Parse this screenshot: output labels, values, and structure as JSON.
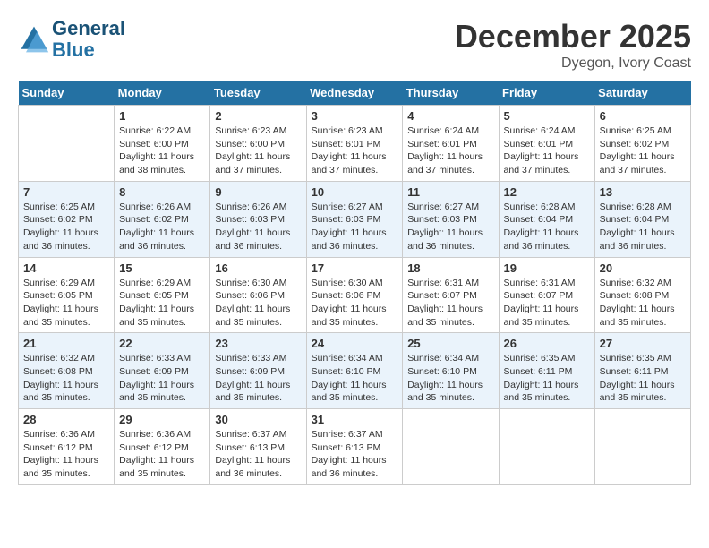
{
  "header": {
    "logo_line1": "General",
    "logo_line2": "Blue",
    "month": "December 2025",
    "location": "Dyegon, Ivory Coast"
  },
  "days_of_week": [
    "Sunday",
    "Monday",
    "Tuesday",
    "Wednesday",
    "Thursday",
    "Friday",
    "Saturday"
  ],
  "weeks": [
    [
      {
        "num": "",
        "empty": true
      },
      {
        "num": "1",
        "sunrise": "6:22 AM",
        "sunset": "6:00 PM",
        "daylight": "11 hours and 38 minutes."
      },
      {
        "num": "2",
        "sunrise": "6:23 AM",
        "sunset": "6:00 PM",
        "daylight": "11 hours and 37 minutes."
      },
      {
        "num": "3",
        "sunrise": "6:23 AM",
        "sunset": "6:01 PM",
        "daylight": "11 hours and 37 minutes."
      },
      {
        "num": "4",
        "sunrise": "6:24 AM",
        "sunset": "6:01 PM",
        "daylight": "11 hours and 37 minutes."
      },
      {
        "num": "5",
        "sunrise": "6:24 AM",
        "sunset": "6:01 PM",
        "daylight": "11 hours and 37 minutes."
      },
      {
        "num": "6",
        "sunrise": "6:25 AM",
        "sunset": "6:02 PM",
        "daylight": "11 hours and 37 minutes."
      }
    ],
    [
      {
        "num": "7",
        "sunrise": "6:25 AM",
        "sunset": "6:02 PM",
        "daylight": "11 hours and 36 minutes."
      },
      {
        "num": "8",
        "sunrise": "6:26 AM",
        "sunset": "6:02 PM",
        "daylight": "11 hours and 36 minutes."
      },
      {
        "num": "9",
        "sunrise": "6:26 AM",
        "sunset": "6:03 PM",
        "daylight": "11 hours and 36 minutes."
      },
      {
        "num": "10",
        "sunrise": "6:27 AM",
        "sunset": "6:03 PM",
        "daylight": "11 hours and 36 minutes."
      },
      {
        "num": "11",
        "sunrise": "6:27 AM",
        "sunset": "6:03 PM",
        "daylight": "11 hours and 36 minutes."
      },
      {
        "num": "12",
        "sunrise": "6:28 AM",
        "sunset": "6:04 PM",
        "daylight": "11 hours and 36 minutes."
      },
      {
        "num": "13",
        "sunrise": "6:28 AM",
        "sunset": "6:04 PM",
        "daylight": "11 hours and 36 minutes."
      }
    ],
    [
      {
        "num": "14",
        "sunrise": "6:29 AM",
        "sunset": "6:05 PM",
        "daylight": "11 hours and 35 minutes."
      },
      {
        "num": "15",
        "sunrise": "6:29 AM",
        "sunset": "6:05 PM",
        "daylight": "11 hours and 35 minutes."
      },
      {
        "num": "16",
        "sunrise": "6:30 AM",
        "sunset": "6:06 PM",
        "daylight": "11 hours and 35 minutes."
      },
      {
        "num": "17",
        "sunrise": "6:30 AM",
        "sunset": "6:06 PM",
        "daylight": "11 hours and 35 minutes."
      },
      {
        "num": "18",
        "sunrise": "6:31 AM",
        "sunset": "6:07 PM",
        "daylight": "11 hours and 35 minutes."
      },
      {
        "num": "19",
        "sunrise": "6:31 AM",
        "sunset": "6:07 PM",
        "daylight": "11 hours and 35 minutes."
      },
      {
        "num": "20",
        "sunrise": "6:32 AM",
        "sunset": "6:08 PM",
        "daylight": "11 hours and 35 minutes."
      }
    ],
    [
      {
        "num": "21",
        "sunrise": "6:32 AM",
        "sunset": "6:08 PM",
        "daylight": "11 hours and 35 minutes."
      },
      {
        "num": "22",
        "sunrise": "6:33 AM",
        "sunset": "6:09 PM",
        "daylight": "11 hours and 35 minutes."
      },
      {
        "num": "23",
        "sunrise": "6:33 AM",
        "sunset": "6:09 PM",
        "daylight": "11 hours and 35 minutes."
      },
      {
        "num": "24",
        "sunrise": "6:34 AM",
        "sunset": "6:10 PM",
        "daylight": "11 hours and 35 minutes."
      },
      {
        "num": "25",
        "sunrise": "6:34 AM",
        "sunset": "6:10 PM",
        "daylight": "11 hours and 35 minutes."
      },
      {
        "num": "26",
        "sunrise": "6:35 AM",
        "sunset": "6:11 PM",
        "daylight": "11 hours and 35 minutes."
      },
      {
        "num": "27",
        "sunrise": "6:35 AM",
        "sunset": "6:11 PM",
        "daylight": "11 hours and 35 minutes."
      }
    ],
    [
      {
        "num": "28",
        "sunrise": "6:36 AM",
        "sunset": "6:12 PM",
        "daylight": "11 hours and 35 minutes."
      },
      {
        "num": "29",
        "sunrise": "6:36 AM",
        "sunset": "6:12 PM",
        "daylight": "11 hours and 35 minutes."
      },
      {
        "num": "30",
        "sunrise": "6:37 AM",
        "sunset": "6:13 PM",
        "daylight": "11 hours and 36 minutes."
      },
      {
        "num": "31",
        "sunrise": "6:37 AM",
        "sunset": "6:13 PM",
        "daylight": "11 hours and 36 minutes."
      },
      {
        "num": "",
        "empty": true
      },
      {
        "num": "",
        "empty": true
      },
      {
        "num": "",
        "empty": true
      }
    ]
  ]
}
